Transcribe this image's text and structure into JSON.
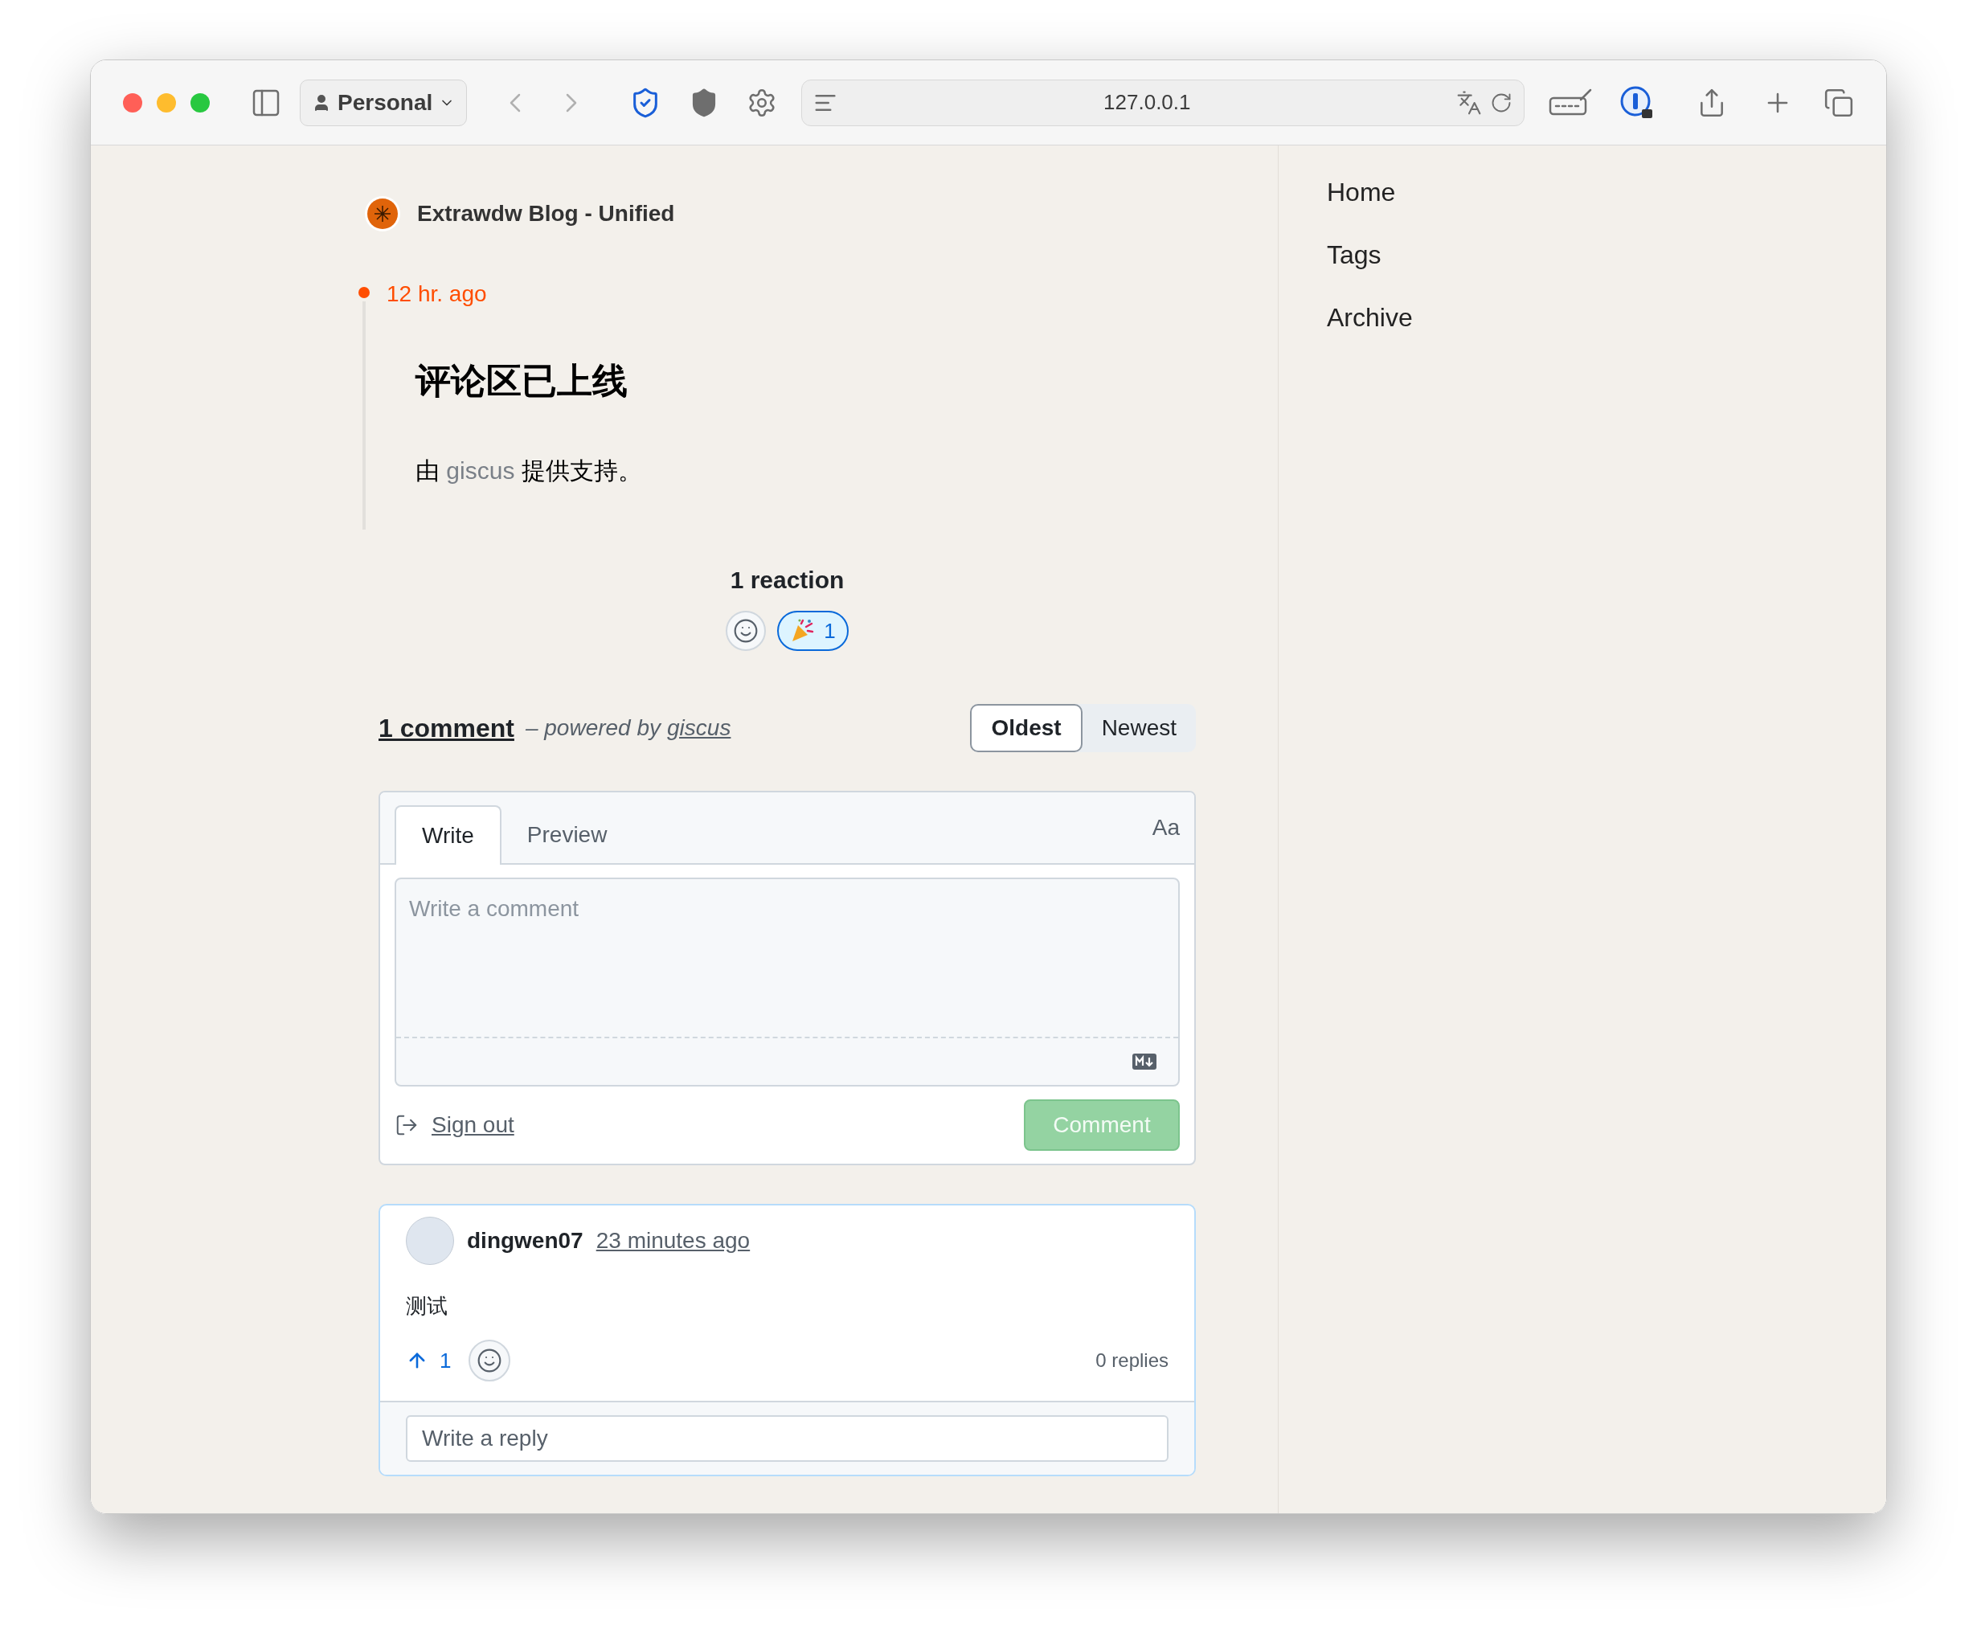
{
  "browser": {
    "profile": "Personal",
    "url": "127.0.0.1"
  },
  "blog": {
    "title": "Extrawdw Blog - Unified"
  },
  "post": {
    "time": "12 hr. ago",
    "title": "评论区已上线",
    "body_before": "由 ",
    "body_link": "giscus",
    "body_after": " 提供支持。"
  },
  "reactions": {
    "title": "1 reaction",
    "items": [
      {
        "kind": "add"
      },
      {
        "kind": "party",
        "count": "1",
        "reacted": true
      }
    ]
  },
  "comments_header": {
    "count_label": "1 comment",
    "powered_by": "– powered by",
    "link": "giscus"
  },
  "sort": [
    {
      "label": "Oldest",
      "selected": true
    },
    {
      "label": "Newest",
      "selected": false
    }
  ],
  "editor": {
    "tabs": [
      {
        "label": "Write",
        "selected": true
      },
      {
        "label": "Preview",
        "selected": false
      }
    ],
    "format_toggle": "Aa",
    "placeholder": "Write a comment",
    "sign_out": "Sign out",
    "submit": {
      "label": "Comment",
      "disabled": true
    }
  },
  "comments": [
    {
      "author": "dingwen07",
      "time": "23 minutes ago",
      "body": "测试",
      "upvotes": "1",
      "upvoted": true,
      "replies": "0 replies",
      "reply_placeholder": "Write a reply"
    }
  ],
  "sidebar": {
    "items": [
      {
        "label": "Home"
      },
      {
        "label": "Tags"
      },
      {
        "label": "Archive"
      }
    ]
  }
}
